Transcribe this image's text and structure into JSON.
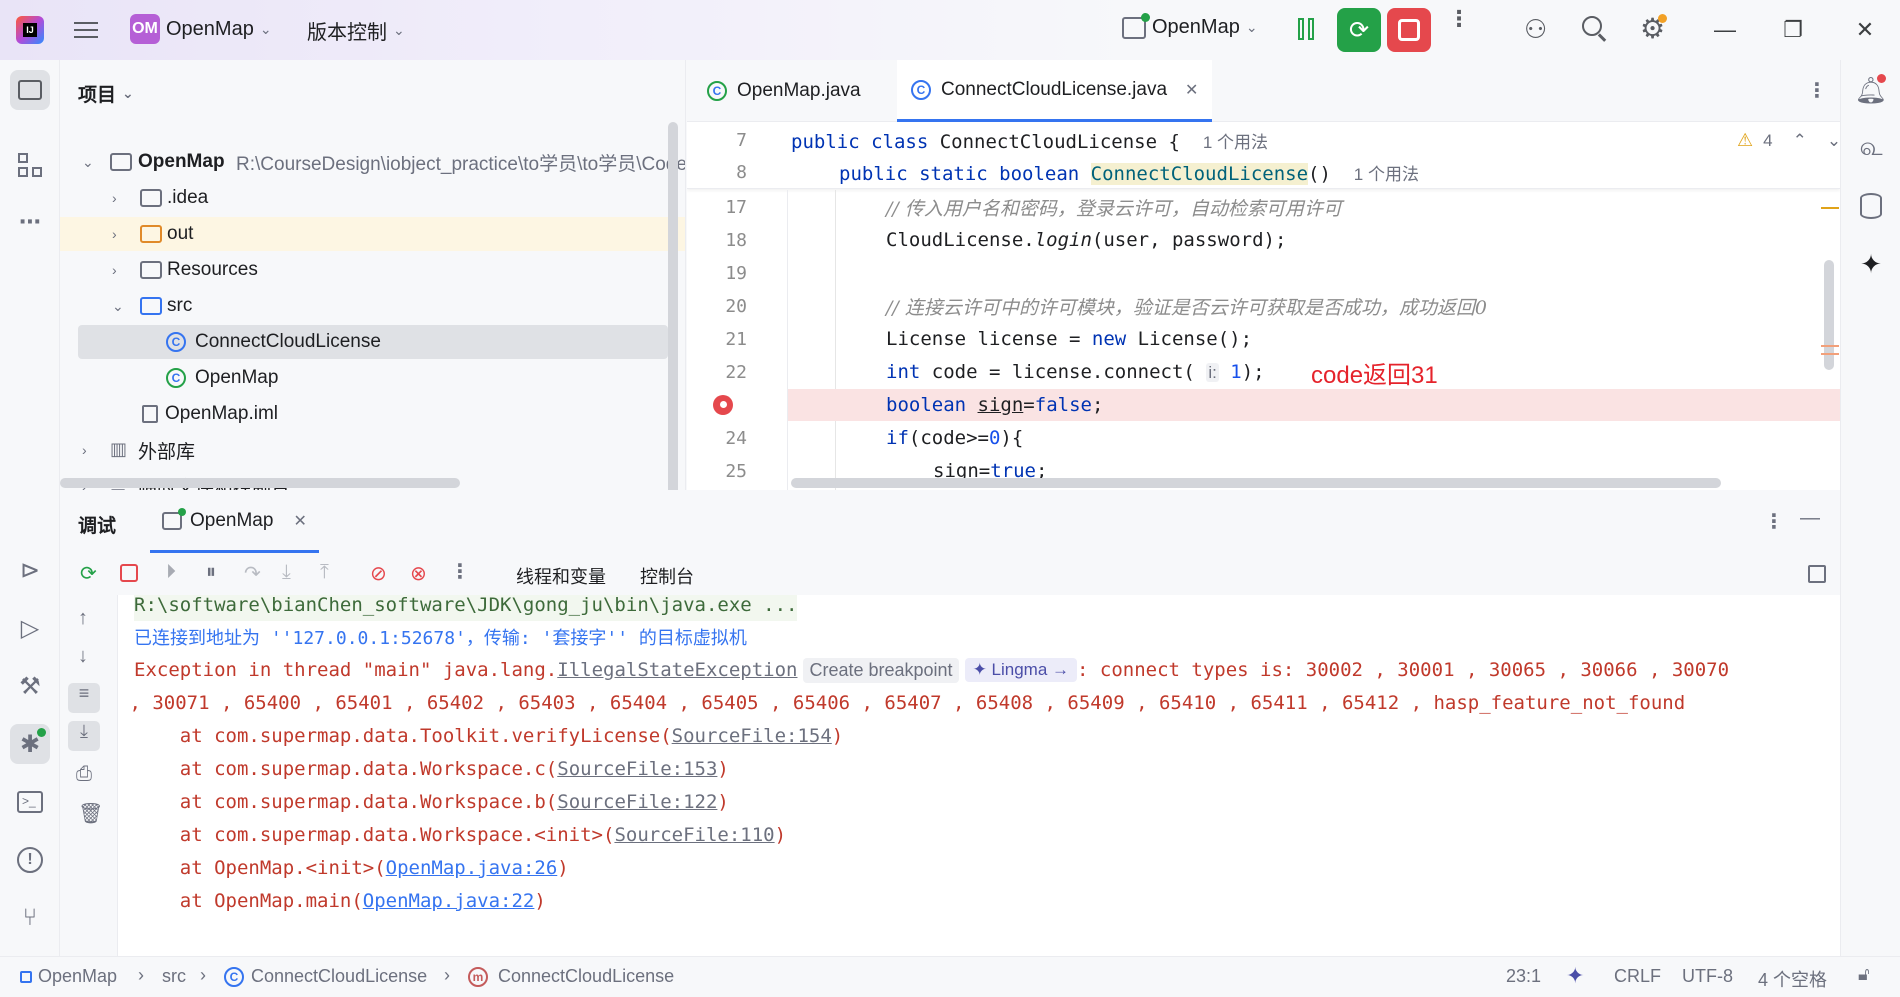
{
  "titlebar": {
    "project_badge": "OM",
    "project_name": "OpenMap",
    "vcs_label": "版本控制",
    "run_config": "OpenMap"
  },
  "project_panel": {
    "title": "项目",
    "items": [
      {
        "label": "OpenMap",
        "path": "R:\\CourseDesign\\iobject_practice\\to学员\\to学员\\Code"
      },
      {
        "label": ".idea"
      },
      {
        "label": "out"
      },
      {
        "label": "Resources"
      },
      {
        "label": "src"
      },
      {
        "label": "ConnectCloudLicense"
      },
      {
        "label": "OpenMap"
      },
      {
        "label": "OpenMap.iml"
      },
      {
        "label": "外部库"
      },
      {
        "label": "临时文件和控制台"
      }
    ]
  },
  "editor": {
    "tabs": [
      {
        "label": "OpenMap.java"
      },
      {
        "label": "ConnectCloudLicense.java"
      }
    ],
    "warning_count": "4",
    "sticky": [
      {
        "line": "7",
        "usage": "1 个用法"
      },
      {
        "line": "8",
        "usage": "1 个用法"
      }
    ],
    "line_numbers": [
      "17",
      "18",
      "19",
      "20",
      "21",
      "22",
      "24",
      "25"
    ],
    "comment_17": "// 传入用户名和密码，登录云许可，自动检索可用许可",
    "comment_20": "// 连接云许可中的许可模块，验证是否云许可获取是否成功，成功返回0",
    "param_hint": "i:",
    "annotation": "code返回31"
  },
  "debug": {
    "title": "调试",
    "session_tab": "OpenMap",
    "tab_threads": "线程和变量",
    "tab_console": "控制台",
    "console": {
      "cmd": "R:\\software\\bianChen_software\\JDK\\gong_ju\\bin\\java.exe ...",
      "connected": "已连接到地址为 ''127.0.0.1:52678'，传输: '套接字'' 的目标虚拟机",
      "exc_prefix": "Exception in thread \"main\" java.lang.",
      "exc_class": "IllegalStateException",
      "create_breakpoint": "Create breakpoint",
      "lingma": "Lingma →",
      "exc_msg": ": connect types is: 30002 , 30001 , 30065 , 30066 , 30070",
      "exc_msg2": " , 30071 , 65400 , 65401 , 65402 , 65403 , 65404 , 65405 , 65406 , 65407 , 65408 , 65409 , 65410 , 65411 , 65412 , hasp_feature_not_found",
      "stack": [
        {
          "prefix": "    at com.supermap.data.Toolkit.verifyLicense(",
          "link": "SourceFile:154",
          "suffix": ")",
          "user": false
        },
        {
          "prefix": "    at com.supermap.data.Workspace.c(",
          "link": "SourceFile:153",
          "suffix": ")",
          "user": false
        },
        {
          "prefix": "    at com.supermap.data.Workspace.b(",
          "link": "SourceFile:122",
          "suffix": ")",
          "user": false
        },
        {
          "prefix": "    at com.supermap.data.Workspace.<init>(",
          "link": "SourceFile:110",
          "suffix": ")",
          "user": false
        },
        {
          "prefix": "    at OpenMap.<init>(",
          "link": "OpenMap.java:26",
          "suffix": ")",
          "user": true
        },
        {
          "prefix": "    at OpenMap.main(",
          "link": "OpenMap.java:22",
          "suffix": ")",
          "user": true
        }
      ]
    }
  },
  "statusbar": {
    "breadcrumb": [
      "OpenMap",
      "src",
      "ConnectCloudLicense",
      "ConnectCloudLicense"
    ],
    "position": "23:1",
    "line_sep": "CRLF",
    "encoding": "UTF-8",
    "indent": "4 个空格"
  },
  "colors": {
    "accent": "#3574f0",
    "error": "#c0392b",
    "breakpoint_line": "#fae3e3",
    "run_green": "#24a148",
    "stop_red": "#e5484d"
  }
}
